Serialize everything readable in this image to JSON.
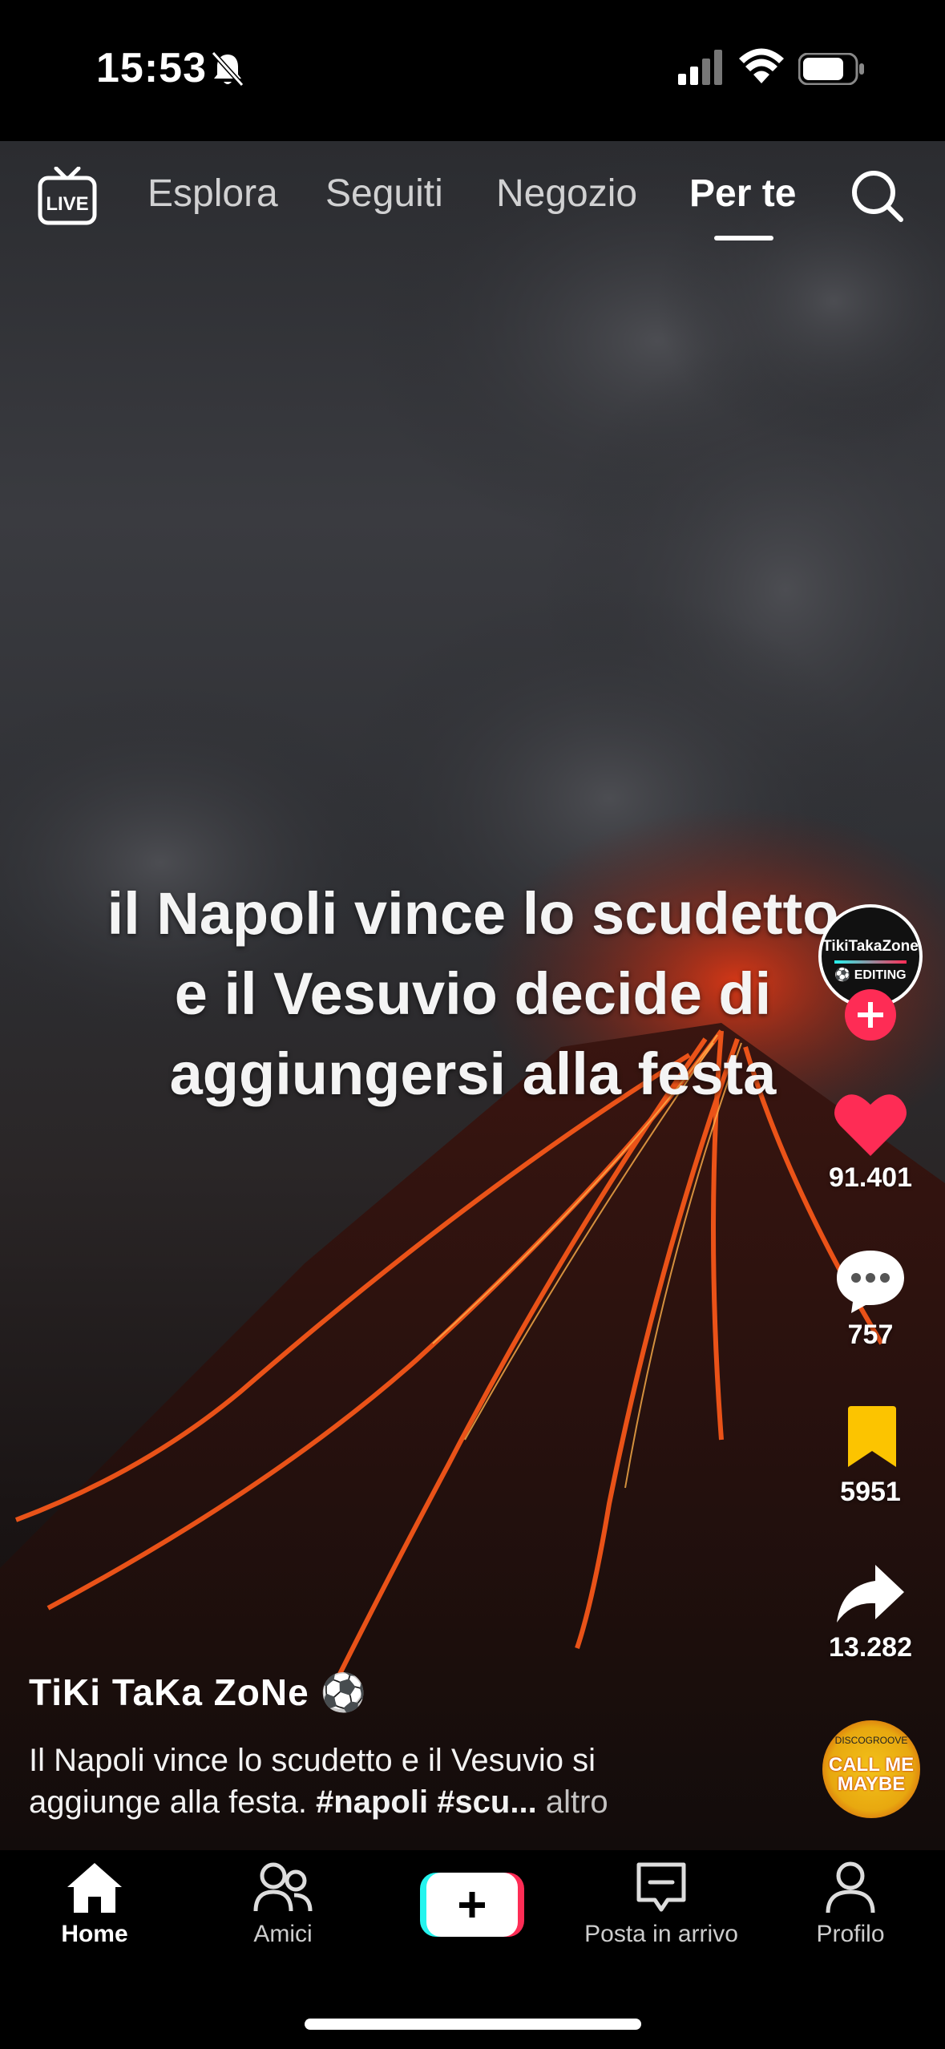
{
  "status_bar": {
    "time": "15:53",
    "icons": [
      "bell-slash-icon",
      "signal-icon",
      "wifi-icon",
      "battery-icon"
    ]
  },
  "top_nav": {
    "live_label": "LIVE",
    "tabs": [
      {
        "label": "Esplora",
        "active": false
      },
      {
        "label": "Seguiti",
        "active": false
      },
      {
        "label": "Negozio",
        "active": false
      },
      {
        "label": "Per te",
        "active": true
      }
    ],
    "search_icon": "search-icon"
  },
  "video": {
    "caption_lines": [
      "il Napoli vince lo scudetto",
      "e il Vesuvio decide di",
      "aggiungersi alla festa"
    ]
  },
  "actions": {
    "avatar_line1": "TikiTakaZone",
    "avatar_line2": "⚽ EDITING",
    "likes": "91.401",
    "comments": "757",
    "saves": "5951",
    "shares": "13.282",
    "music_disc_line1": "DISCOGROOVE",
    "music_disc_line2": "CALL ME MAYBE"
  },
  "post": {
    "author": "TiKi TaKa ZoNe ⚽",
    "description_line1": "Il Napoli vince lo scudetto e il Vesuvio si",
    "description_prefix": "aggiunge alla festa. ",
    "description_tags": "#napoli #scu...",
    "description_more": " altro"
  },
  "bottom_nav": {
    "items": [
      {
        "label": "Home",
        "active": true
      },
      {
        "label": "Amici",
        "active": false
      },
      {
        "label": "Posta in arrivo",
        "active": false
      },
      {
        "label": "Profilo",
        "active": false
      }
    ]
  },
  "colors": {
    "accent_red": "#fe2c55",
    "accent_cyan": "#25f4ee",
    "save_yellow": "#fcc400"
  }
}
